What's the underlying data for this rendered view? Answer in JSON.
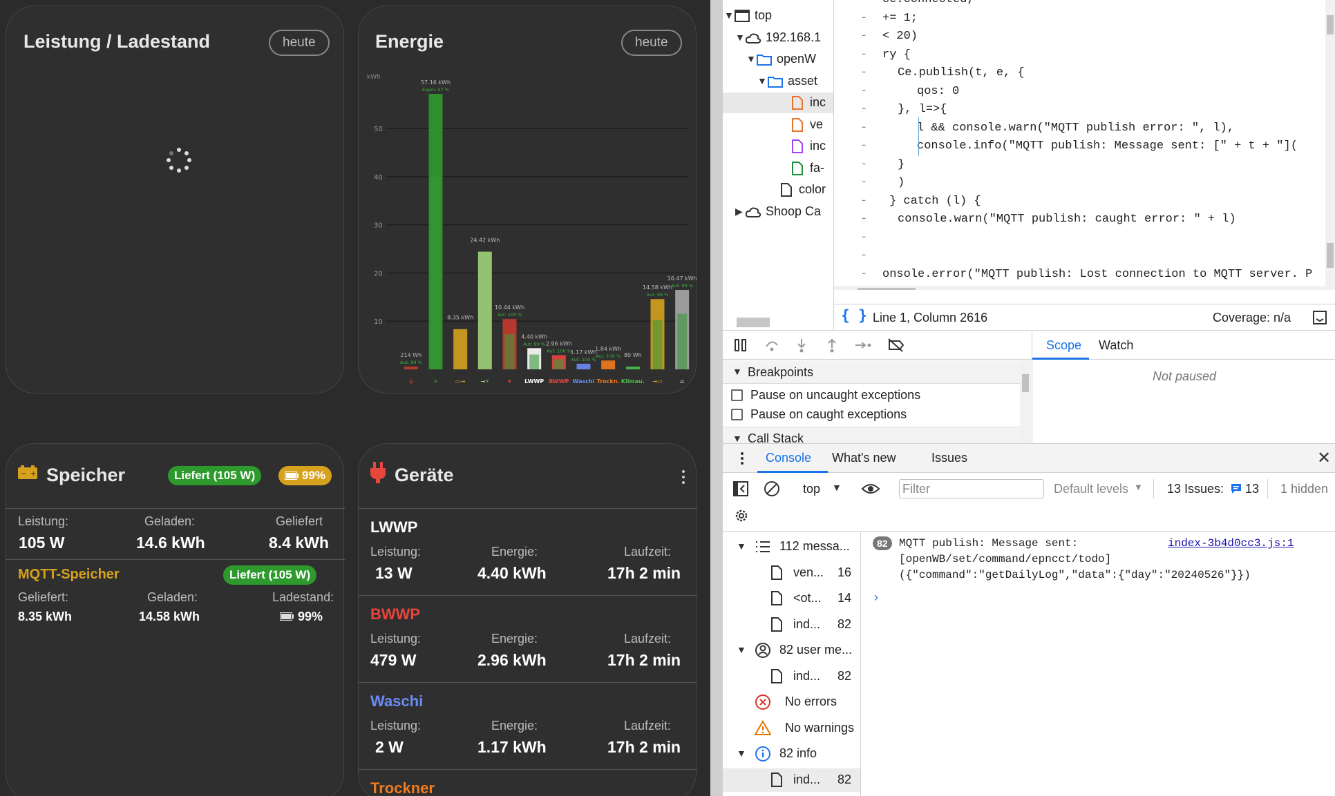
{
  "dashboard": {
    "power_card": {
      "title": "Leistung / Ladestand",
      "button": "heute"
    },
    "energy_card": {
      "title": "Energie",
      "button": "heute"
    },
    "storage_card": {
      "title": "Speicher",
      "status_badge": "Liefert (105 W)",
      "soc_badge": "99%",
      "labels": {
        "power": "Leistung:",
        "charged": "Geladen:",
        "delivered": "Geliefert"
      },
      "values": {
        "power": "105 W",
        "charged": "14.6 kWh",
        "delivered": "8.4 kWh"
      },
      "sub": {
        "name": "MQTT-Speicher",
        "badge": "Liefert (105 W)",
        "labels": {
          "delivered": "Geliefert:",
          "charged": "Geladen:",
          "soc": "Ladestand:"
        },
        "values": {
          "delivered": "8.35 kWh",
          "charged": "14.58 kWh",
          "soc": "99%"
        }
      }
    },
    "devices_card": {
      "title": "Geräte",
      "labels": {
        "power": "Leistung:",
        "energy": "Energie:",
        "runtime": "Laufzeit:"
      },
      "devices": [
        {
          "name": "LWWP",
          "color": "#ffffff",
          "power": "13 W",
          "energy": "4.40 kWh",
          "runtime": "17h 2 min"
        },
        {
          "name": "BWWP",
          "color": "#e8453c",
          "power": "479 W",
          "energy": "2.96 kWh",
          "runtime": "17h 2 min"
        },
        {
          "name": "Waschi",
          "color": "#6b8cf5",
          "power": "2 W",
          "energy": "1.17 kWh",
          "runtime": "17h 2 min"
        },
        {
          "name": "Trockner",
          "color": "#f07b1e"
        }
      ]
    }
  },
  "chart_data": {
    "type": "bar",
    "ylabel": "kWh",
    "ylim": [
      0,
      60
    ],
    "yticks": [
      10,
      20,
      30,
      40,
      50
    ],
    "categories": [
      "Netz",
      "PV",
      "Speicher",
      "E-Auto",
      "Haus-Plug",
      "LWWP",
      "BWWP",
      "Waschi",
      "Trockn.",
      "Klimau.",
      "Speicher-Laden",
      "Haus"
    ],
    "bars": [
      {
        "label": "214 Wh",
        "sub": "Aut: 99 %",
        "value": 0.214,
        "color": "#c83a2e",
        "icon": "grid"
      },
      {
        "label": "57.16 kWh",
        "sub": "Eigen: 57 %",
        "value": 57.16,
        "color": "#2e9a2e",
        "icon": "pv"
      },
      {
        "label": "8.35 kWh",
        "sub": "",
        "value": 8.35,
        "color": "#d6a21e",
        "icon": "battery-out"
      },
      {
        "label": "24.42 kWh",
        "sub": "",
        "value": 24.42,
        "color": "#9ed47a",
        "icon": "charge"
      },
      {
        "label": "10.44 kWh",
        "sub": "Aut: 100 %",
        "value": 10.44,
        "color": "#c83a2e",
        "icon": "plug"
      },
      {
        "label": "4.40 kWh",
        "sub": "Aut: 99 %",
        "value": 4.4,
        "color": "#ffffff",
        "icon": "LWWP"
      },
      {
        "label": "2.96 kWh",
        "sub": "Aut: 100 %",
        "value": 2.96,
        "color": "#e8453c",
        "icon": "BWWP"
      },
      {
        "label": "1.17 kWh",
        "sub": "Aut: 100 %",
        "value": 1.17,
        "color": "#6b8cf5",
        "icon": "Waschi"
      },
      {
        "label": "1.84 kWh",
        "sub": "Aut: 100 %",
        "value": 1.84,
        "color": "#f07b1e",
        "icon": "Trockn."
      },
      {
        "label": "80 Wh",
        "sub": "",
        "value": 0.08,
        "color": "#4cc04c",
        "icon": "Klimau."
      },
      {
        "label": "14.58 kWh",
        "sub": "Aut: 99 %",
        "value": 14.58,
        "color": "#d6a21e",
        "icon": "battery-in"
      },
      {
        "label": "16.47 kWh",
        "sub": "Aut: 99 %",
        "value": 16.47,
        "color": "#a8a8a8",
        "icon": "house"
      }
    ]
  },
  "devtools": {
    "tree": [
      {
        "label": "top",
        "icon": "frame-icon"
      },
      {
        "label": "192.168.1",
        "icon": "cloud-icon"
      },
      {
        "label": "openW",
        "icon": "folder-icon"
      },
      {
        "label": "asset",
        "icon": "folder-icon"
      },
      {
        "label": "inc",
        "icon": "file-orange-icon"
      },
      {
        "label": "ve",
        "icon": "file-orange-icon"
      },
      {
        "label": "inc",
        "icon": "file-purple-icon"
      },
      {
        "label": "fa-",
        "icon": "file-green-icon"
      },
      {
        "label": "color",
        "icon": "file-icon"
      },
      {
        "label": "Shoop Ca",
        "icon": "cloud-icon"
      }
    ],
    "code": [
      "ce.connected,",
      "+= 1;",
      "< 20)",
      "ry {",
      "  Ce.publish(t, e, {",
      "      qos: 0",
      "  }, l=>{",
      "      l && console.warn(\"MQTT publish error: \", l),",
      "      console.info(\"MQTT publish: Message sent: [\" + t + \"](",
      "  }",
      "  )",
      "} catch (l) {",
      "  console.warn(\"MQTT publish: caught error: \" + l)",
      "",
      "",
      "onsole.error(\"MQTT publish: Lost connection to MQTT server. P"
    ],
    "status": {
      "position": "Line 1, Column 2616",
      "coverage": "Coverage: n/a"
    },
    "debugger": {
      "breakpoints": "Breakpoints",
      "pause_uncaught": "Pause on uncaught exceptions",
      "pause_caught": "Pause on caught exceptions",
      "call_stack": "Call Stack",
      "scope_tab": "Scope",
      "watch_tab": "Watch",
      "not_paused": "Not paused"
    },
    "drawer_tabs": [
      "Console",
      "What's new",
      "Issues"
    ],
    "console_toolbar": {
      "context": "top",
      "filter_placeholder": "Filter",
      "levels": "Default levels",
      "issues": "13 Issues:",
      "issues_count": "13",
      "hidden": "1 hidden"
    },
    "sidebar": [
      {
        "label": "112 messa...",
        "count": "",
        "icon": "list-icon"
      },
      {
        "label": "ven...",
        "count": "16",
        "icon": "file-icon"
      },
      {
        "label": "<ot...",
        "count": "14",
        "icon": "file-icon"
      },
      {
        "label": "ind...",
        "count": "82",
        "icon": "file-icon"
      },
      {
        "label": "82 user me...",
        "count": "",
        "icon": "user-icon"
      },
      {
        "label": "ind...",
        "count": "82",
        "icon": "file-icon"
      },
      {
        "label": "No errors",
        "count": "",
        "icon": "error-icon"
      },
      {
        "label": "No warnings",
        "count": "",
        "icon": "warning-icon"
      },
      {
        "label": "82 info",
        "count": "",
        "icon": "info-icon"
      },
      {
        "label": "ind...",
        "count": "82",
        "icon": "file-icon"
      }
    ],
    "message": {
      "count": "82",
      "line1": "MQTT publish: Message sent:",
      "line2": "[openWB/set/command/epncct/todo]",
      "line3": "({\"command\":\"getDailyLog\",\"data\":{\"day\":\"20240526\"}})",
      "source": "index-3b4d0cc3.js:1"
    }
  }
}
